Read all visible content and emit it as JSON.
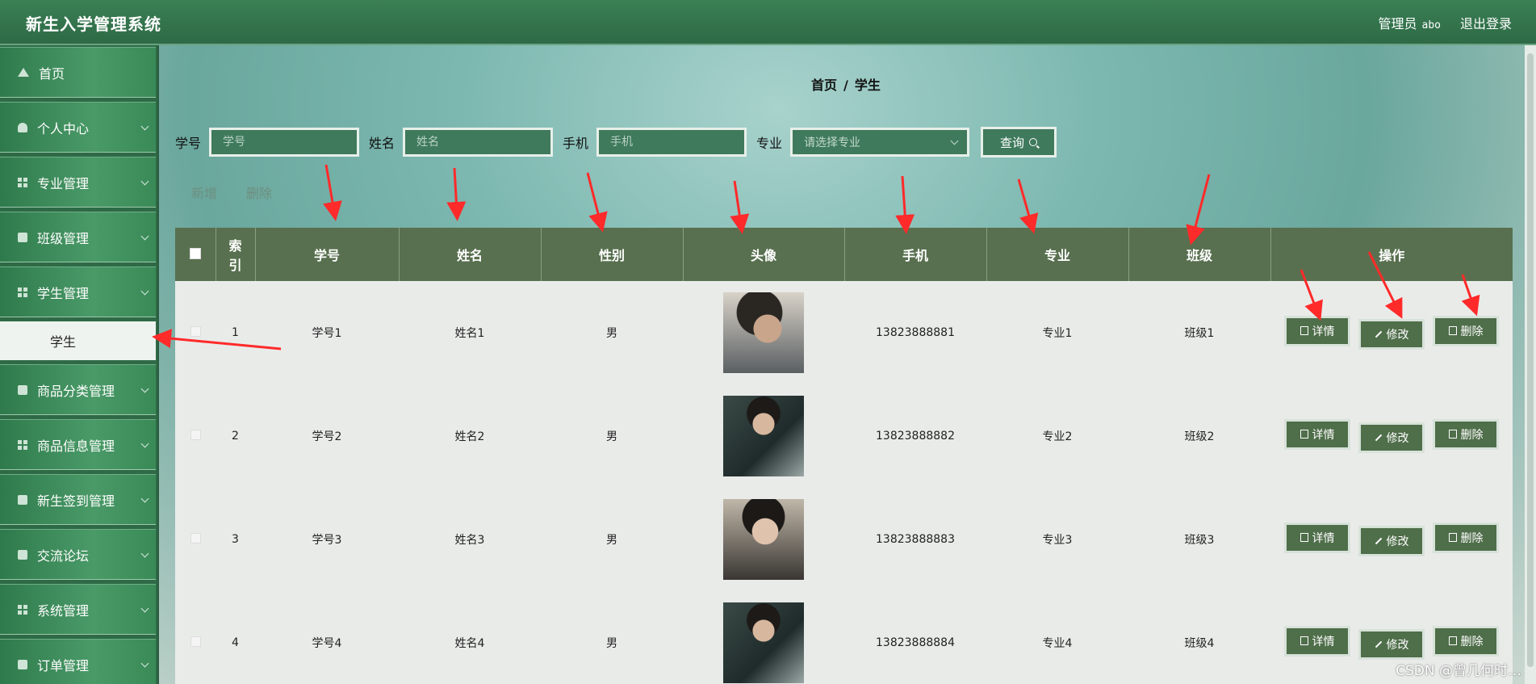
{
  "header": {
    "app_title": "新生入学管理系统",
    "role_label": "管理员",
    "username": "abo",
    "logout_label": "退出登录"
  },
  "sidebar": {
    "items": [
      {
        "label": "首页",
        "icon": "home-icon",
        "expandable": false
      },
      {
        "label": "个人中心",
        "icon": "user-icon",
        "expandable": true
      },
      {
        "label": "专业管理",
        "icon": "grid-icon",
        "expandable": true
      },
      {
        "label": "班级管理",
        "icon": "briefcase-icon",
        "expandable": true
      },
      {
        "label": "学生管理",
        "icon": "grid-icon",
        "expandable": true
      },
      {
        "label": "商品分类管理",
        "icon": "book-icon",
        "expandable": true
      },
      {
        "label": "商品信息管理",
        "icon": "grid-icon",
        "expandable": true
      },
      {
        "label": "新生签到管理",
        "icon": "cup-icon",
        "expandable": true
      },
      {
        "label": "交流论坛",
        "icon": "clipboard-icon",
        "expandable": true
      },
      {
        "label": "系统管理",
        "icon": "grid-icon",
        "expandable": true
      },
      {
        "label": "订单管理",
        "icon": "clipboard-icon",
        "expandable": true
      }
    ],
    "submenu_active": "学生"
  },
  "breadcrumb": {
    "home": "首页",
    "separator": "/",
    "current": "学生"
  },
  "search": {
    "student_id_label": "学号",
    "student_id_placeholder": "学号",
    "name_label": "姓名",
    "name_placeholder": "姓名",
    "phone_label": "手机",
    "phone_placeholder": "手机",
    "major_label": "专业",
    "major_placeholder": "请选择专业",
    "query_label": "查询"
  },
  "actions": {
    "add_label": "新增",
    "delete_label": "删除"
  },
  "table": {
    "headers": {
      "index_line1": "索",
      "index_line2": "引",
      "student_id": "学号",
      "name": "姓名",
      "gender": "性别",
      "avatar": "头像",
      "phone": "手机",
      "major": "专业",
      "class": "班级",
      "operations": "操作"
    },
    "rows": [
      {
        "index": "1",
        "student_id": "学号1",
        "name": "姓名1",
        "gender": "男",
        "phone": "13823888881",
        "major": "专业1",
        "class": "班级1"
      },
      {
        "index": "2",
        "student_id": "学号2",
        "name": "姓名2",
        "gender": "男",
        "phone": "13823888882",
        "major": "专业2",
        "class": "班级2"
      },
      {
        "index": "3",
        "student_id": "学号3",
        "name": "姓名3",
        "gender": "男",
        "phone": "13823888883",
        "major": "专业3",
        "class": "班级3"
      },
      {
        "index": "4",
        "student_id": "学号4",
        "name": "姓名4",
        "gender": "男",
        "phone": "13823888884",
        "major": "专业4",
        "class": "班级4"
      }
    ],
    "op_detail": "详情",
    "op_edit": "修改",
    "op_delete": "删除"
  },
  "watermark": "CSDN @曾几何时…",
  "colors": {
    "header_bg": "#2d6a45",
    "table_header_bg": "#58704f",
    "annotation_arrow": "#ff2a2a"
  }
}
